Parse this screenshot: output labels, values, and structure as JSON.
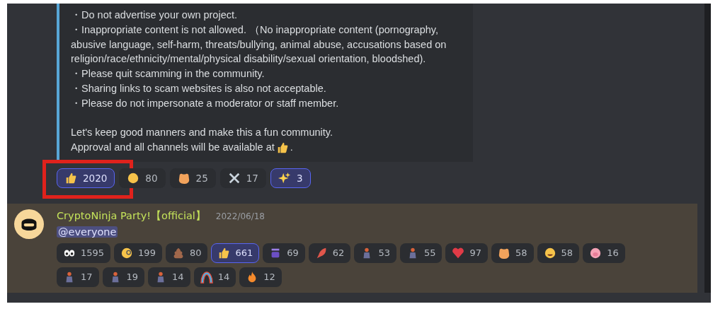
{
  "embed": {
    "lines": [
      {
        "kind": "bullet",
        "text": "・Do not advertise your own project."
      },
      {
        "kind": "bullet",
        "text": "・Inappropriate content is not allowed. （No inappropriate content (pornography, abusive language, self-harm, threats/bullying, animal abuse, accusations based on religion/race/ethnicity/mental/physical disability/sexual orientation, bloodshed)."
      },
      {
        "kind": "bullet",
        "text": "・Please quit scamming in the community."
      },
      {
        "kind": "bullet",
        "text": "・Sharing links to scam websites is also not acceptable."
      },
      {
        "kind": "bullet",
        "text": "・Please do not impersonate a moderator or staff member."
      },
      {
        "kind": "gap"
      },
      {
        "kind": "plain",
        "text": "Let's keep good manners and make this a fun community."
      },
      {
        "kind": "with-icon",
        "text": "Approval and all channels will be available at",
        "after": "."
      }
    ]
  },
  "reactions": [
    {
      "kind": "thumbs-up",
      "count": "2020",
      "selected": true,
      "annotated": true
    },
    {
      "kind": "face",
      "count": "80",
      "selected": false,
      "annotated": false
    },
    {
      "kind": "hamster",
      "count": "25",
      "selected": false,
      "annotated": false
    },
    {
      "kind": "swords",
      "count": "17",
      "selected": false,
      "annotated": false
    },
    {
      "kind": "sparkles",
      "count": "3",
      "selected": true,
      "annotated": false
    }
  ],
  "message": {
    "author": "CryptoNinja Party!【official】",
    "date": "2022/06/18",
    "mention": "@everyone",
    "reactions": [
      {
        "kind": "eyes",
        "count": "1595",
        "selected": false
      },
      {
        "kind": "monocle-face",
        "count": "199",
        "selected": false
      },
      {
        "kind": "poop",
        "count": "80",
        "selected": false
      },
      {
        "kind": "thumbs-up",
        "count": "661",
        "selected": true
      },
      {
        "kind": "jar",
        "count": "69",
        "selected": false
      },
      {
        "kind": "leaf",
        "count": "62",
        "selected": false
      },
      {
        "kind": "figure",
        "count": "53",
        "selected": false
      },
      {
        "kind": "figure",
        "count": "55",
        "selected": false
      },
      {
        "kind": "heart",
        "count": "97",
        "selected": false
      },
      {
        "kind": "hamster",
        "count": "58",
        "selected": false
      },
      {
        "kind": "face",
        "count": "58",
        "selected": false
      },
      {
        "kind": "pig",
        "count": "16",
        "selected": false
      },
      {
        "kind": "figure",
        "count": "17",
        "selected": false
      },
      {
        "kind": "figure",
        "count": "19",
        "selected": false
      },
      {
        "kind": "figure",
        "count": "14",
        "selected": false
      },
      {
        "kind": "rainbow",
        "count": "14",
        "selected": false
      },
      {
        "kind": "fire",
        "count": "12",
        "selected": false
      }
    ]
  }
}
